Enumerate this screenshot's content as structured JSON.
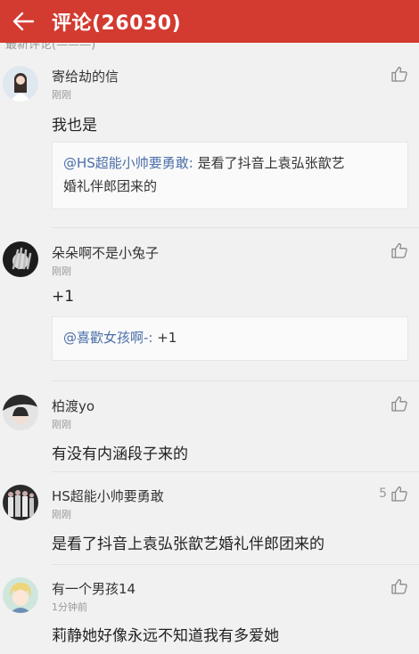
{
  "header": {
    "title": "评论(26030)",
    "background_color": "#d33a30",
    "back_icon": "back-arrow-icon"
  },
  "truncated_text": "最新评论(———)",
  "comments": [
    {
      "user": "寄给劫的信",
      "time": "刚刚",
      "text": "我也是",
      "quote_user": "@HS超能小帅要勇敢:",
      "quote_line1": " 是看了抖音上袁弘张歆艺",
      "quote_line2": "婚礼伴郎团来的",
      "like_count": ""
    },
    {
      "user": "朵朵啊不是小兔子",
      "time": "刚刚",
      "text": "+1",
      "quote_user": "@喜歡女孩啊-:",
      "quote_line1": " +1",
      "like_count": ""
    },
    {
      "user": "柏渡yo",
      "time": "刚刚",
      "text": "有没有内涵段子来的",
      "like_count": ""
    },
    {
      "user": "HS超能小帅要勇敢",
      "time": "刚刚",
      "text": "是看了抖音上袁弘张歆艺婚礼伴郎团来的",
      "like_count": "5"
    },
    {
      "user": "有一个男孩14",
      "time": "1分钟前",
      "text": "莉静她好像永远不知道我有多爱她",
      "like_count": ""
    }
  ]
}
